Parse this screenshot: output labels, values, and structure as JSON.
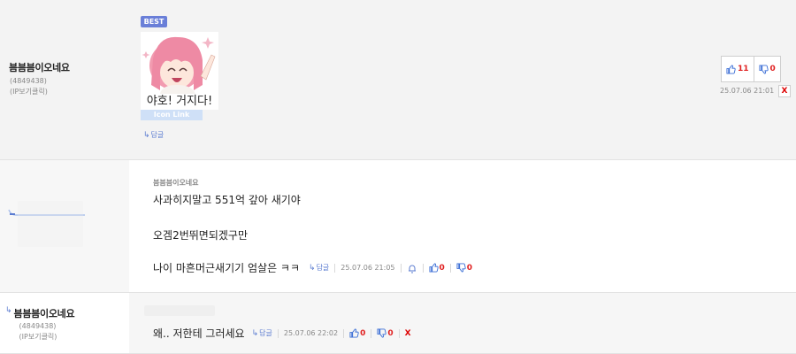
{
  "comments": [
    {
      "author": "븜븜븜이오네요",
      "id": "(4849438)",
      "ip_label": "(IP보기클릭)",
      "badge": "BEST",
      "sticker_caption": "야호! 거지다!",
      "icon_link": "Icon Link",
      "reply_label": "답글",
      "likes": "11",
      "dislikes": "0",
      "date": "25.07.06 21:01",
      "delete_label": "X"
    },
    {
      "author": "븜븜븜이오네요",
      "lines": [
        "사과히지말고 551억 갚아 새기야",
        "오겜2번뛰면되겠구만",
        "나이 마흔머근새기기 엄살은  ㅋㅋ"
      ],
      "reply_label": "답글",
      "date": "25.07.06 21:05",
      "likes": "0",
      "dislikes": "0"
    },
    {
      "author": "븜븜븜이오네요",
      "id": "(4849438)",
      "ip_label": "(IP보기클릭)",
      "text": "왜.. 저한테 그러세요",
      "reply_label": "답글",
      "date": "25.07.06 22:02",
      "likes": "0",
      "dislikes": "0",
      "delete_label": "X"
    }
  ],
  "colors": {
    "accent": "#5a7bd0",
    "vote_count": "#e02020",
    "badge": "#6a7fd8"
  }
}
